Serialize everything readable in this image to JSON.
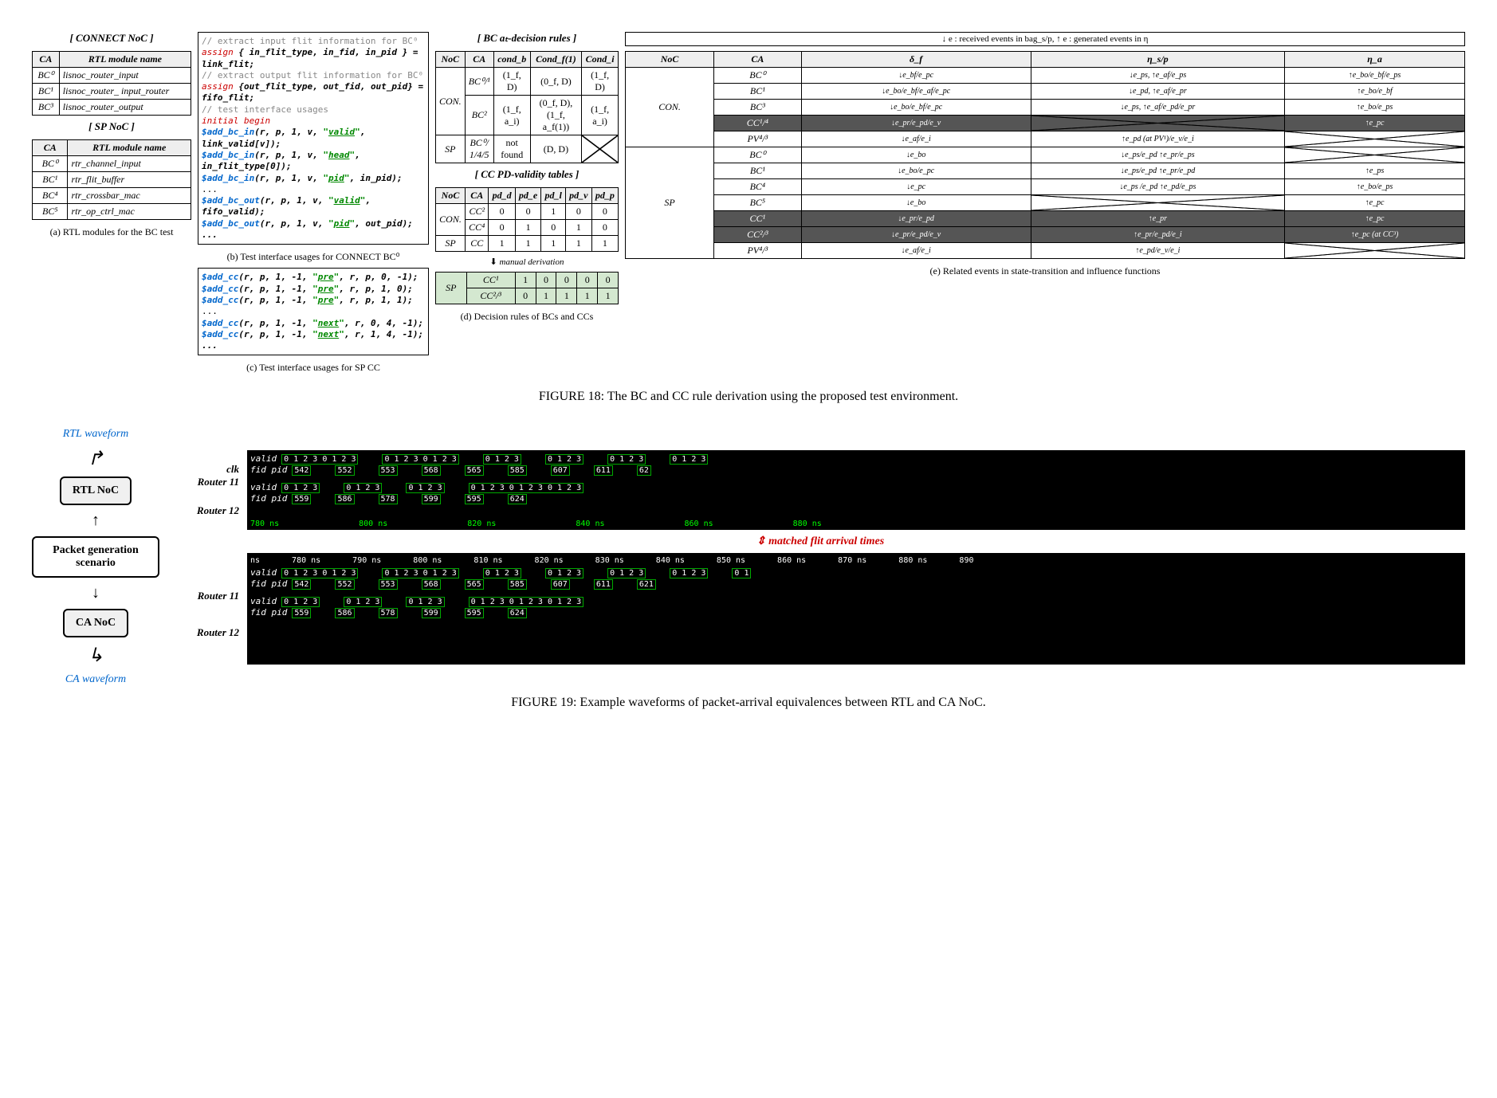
{
  "fig18": {
    "col_a": {
      "title1": "[ CONNECT NoC ]",
      "headers": [
        "CA",
        "RTL module name"
      ],
      "rows1": [
        [
          "BC⁰",
          "lisnoc_router_input"
        ],
        [
          "BC¹",
          "lisnoc_router_ input_router"
        ],
        [
          "BC³",
          "lisnoc_router_output"
        ]
      ],
      "title2": "[ SP NoC ]",
      "rows2": [
        [
          "BC⁰",
          "rtr_channel_input"
        ],
        [
          "BC¹",
          "rtr_flit_buffer"
        ],
        [
          "BC⁴",
          "rtr_crossbar_mac"
        ],
        [
          "BC⁵",
          "rtr_op_ctrl_mac"
        ]
      ],
      "caption": "(a) RTL modules for the BC test"
    },
    "col_b": {
      "lines": [
        {
          "type": "comment",
          "text": "// extract input flit information for BC⁰"
        },
        {
          "type": "assign",
          "text": "assign { in_flit_type, in_fid, in_pid } = link_flit;"
        },
        {
          "type": "comment",
          "text": "// extract output flit information for BC⁰"
        },
        {
          "type": "assign",
          "text": "assign {out_flit_type, out_fid, out_pid} = fifo_flit;"
        },
        {
          "type": "comment",
          "text": "// test interface usages"
        },
        {
          "type": "initial",
          "text": "initial begin"
        },
        {
          "type": "call",
          "fn": "$add_bc_in",
          "args": "(r, p, 1, v, \"valid\", link_valid[v]);"
        },
        {
          "type": "call",
          "fn": "$add_bc_in",
          "args": "(r, p, 1, v, \"head\", in_flit_type[0]);"
        },
        {
          "type": "call",
          "fn": "$add_bc_in",
          "args": "(r, p, 1, v, \"pid\", in_pid);"
        },
        {
          "type": "plain",
          "text": "..."
        },
        {
          "type": "call",
          "fn": "$add_bc_out",
          "args": "(r, p, 1, v, \"valid\", fifo_valid);"
        },
        {
          "type": "call",
          "fn": "$add_bc_out",
          "args": "(r, p, 1, v, \"pid\", out_pid);   ..."
        }
      ],
      "caption_b": "(b) Test interface usages for CONNECT BC⁰",
      "lines_c": [
        {
          "fn": "$add_cc",
          "args": "(r, p, 1, -1, \"pre\", r, p, 0, -1);"
        },
        {
          "fn": "$add_cc",
          "args": "(r, p, 1, -1, \"pre\", r, p, 1, 0);"
        },
        {
          "fn": "$add_cc",
          "args": "(r, p, 1, -1, \"pre\", r, p, 1, 1);"
        },
        {
          "fn": "plain",
          "args": "..."
        },
        {
          "fn": "$add_cc",
          "args": "(r, p, 1, -1, \"next\", r, 0, 4, -1);"
        },
        {
          "fn": "$add_cc",
          "args": "(r, p, 1, -1, \"next\", r, 1, 4, -1);   ..."
        }
      ],
      "caption_c": "(c) Test interface usages for SP CC"
    },
    "col_d": {
      "title1": "[ BC aₜ-decision rules ]",
      "t1_headers": [
        "NoC",
        "CA",
        "cond_b",
        "Cond_f(1)",
        "Cond_i"
      ],
      "t1_rows": [
        [
          "CON.",
          "BC⁰/¹",
          "(1_f, D)",
          "(0_f, D)",
          "(1_f, D)"
        ],
        [
          "",
          "BC²",
          "(1_f, a_i)",
          "(0_f, D), (1_f, a_f(1))",
          "(1_f, a_i)"
        ],
        [
          "SP",
          "BC⁰/ 1/4/5",
          "not found",
          "(D, D)",
          "CROSS"
        ]
      ],
      "title2": "[ CC PD-validity tables ]",
      "t2_headers": [
        "NoC",
        "CA",
        "pd_d",
        "pd_e",
        "pd_l",
        "pd_v",
        "pd_p"
      ],
      "t2_rows": [
        [
          "CON.",
          "CC²",
          "0",
          "0",
          "1",
          "0",
          "0"
        ],
        [
          "",
          "CC⁴",
          "0",
          "1",
          "0",
          "1",
          "0"
        ],
        [
          "SP",
          "CC",
          "1",
          "1",
          "1",
          "1",
          "1"
        ]
      ],
      "deriv_label": "manual derivation",
      "t3_rows": [
        [
          "SP",
          "CC¹",
          "1",
          "0",
          "0",
          "0",
          "0"
        ],
        [
          "",
          "CC²/³",
          "0",
          "1",
          "1",
          "1",
          "1"
        ]
      ],
      "caption": "(d) Decision rules of BCs and CCs"
    },
    "col_e": {
      "legend": "↓ e : received events in bag_s/p, ↑ e : generated events in η",
      "headers": [
        "NoC",
        "CA",
        "δ_f",
        "η_s/p",
        "η_a"
      ],
      "rows_con": [
        {
          "ca": "BC⁰",
          "d": "↓e_bf/e_pc",
          "n": "↓e_ps, ↑e_af/e_ps",
          "a": "↑e_bo/e_bf/e_ps"
        },
        {
          "ca": "BC¹",
          "d": "↓e_bo/e_bf/e_af/e_pc",
          "n": "↓e_pd, ↑e_af/e_pr",
          "a": "↑e_bo/e_bf"
        },
        {
          "ca": "BC³",
          "d": "↓e_bo/e_bf/e_pc",
          "n": "↓e_ps, ↑e_af/e_pd/e_pr",
          "a": "↑e_bo/e_ps"
        },
        {
          "ca": "CC¹/⁴",
          "d": "↓e_pr/e_pd/e_v",
          "n": "CROSS",
          "a": "↑e_pc",
          "dark": true
        },
        {
          "ca": "PV⁴/³",
          "d": "↓e_af/e_i",
          "n": "↑e_pd (at PV¹)/e_v/e_i",
          "a": "CROSS"
        }
      ],
      "rows_sp": [
        {
          "ca": "BC⁰",
          "d": "↓e_bo",
          "n": "↓e_ps/e_pd ↑e_pr/e_ps",
          "a": "CROSS"
        },
        {
          "ca": "BC¹",
          "d": "↓e_bo/e_pc",
          "n": "↓e_ps/e_pd ↑e_pr/e_pd",
          "a": "↑e_ps"
        },
        {
          "ca": "BC⁴",
          "d": "↓e_pc",
          "n": "↓e_ps /e_pd ↑e_pd/e_ps",
          "a": "↑e_bo/e_ps"
        },
        {
          "ca": "BC⁵",
          "d": "↓e_bo",
          "n": "CROSS",
          "a": "↑e_pc"
        },
        {
          "ca": "CC¹",
          "d": "↓e_pr/e_pd",
          "n": "↑e_pr",
          "a": "↑e_pc",
          "dark": true
        },
        {
          "ca": "CC²/³",
          "d": "↓e_pr/e_pd/e_v",
          "n": "↑e_pr/e_pd/e_i",
          "a": "↑e_pc (at CC³)",
          "dark": true
        },
        {
          "ca": "PV⁴/³",
          "d": "↓e_af/e_i",
          "n": "↑e_pd/e_v/e_i",
          "a": "CROSS"
        }
      ],
      "noc_con": "CON.",
      "noc_sp": "SP",
      "caption": "(e) Related events in state-transition and influence functions"
    },
    "caption": "FIGURE 18: The BC and CC rule derivation using the proposed test environment."
  },
  "fig19": {
    "rtl_waveform_label": "RTL waveform",
    "ca_waveform_label": "CA waveform",
    "rtl_noc": "RTL NoC",
    "pkt_gen": "Packet generation scenario",
    "ca_noc": "CA NoC",
    "clk": "clk",
    "router11": "Router 11",
    "router12": "Router 12",
    "sigs": [
      "valid",
      "fid",
      "pid"
    ],
    "matched": "matched flit arrival times",
    "rtl_wave": {
      "r11_seq": [
        "0 1 2 3 0 1 2 3",
        "0 1 2 3 0 1 2 3",
        "0 1 2 3",
        "0 1 2 3",
        "0 1 2 3",
        "0 1 2 3"
      ],
      "r11_pid": [
        "542",
        "552",
        "553",
        "568",
        "565",
        "585",
        "607",
        "611",
        "62"
      ],
      "r12_seq": [
        "0 1 2 3",
        "0 1 2 3",
        "0 1 2 3",
        "0 1 2 3 0 1 2 3 0 1 2 3"
      ],
      "r12_pid": [
        "559",
        "586",
        "578",
        "599",
        "595",
        "624"
      ],
      "times": [
        "780 ns",
        "800 ns",
        "820 ns",
        "840 ns",
        "860 ns",
        "880 ns"
      ]
    },
    "ca_wave": {
      "times_top": [
        "ns",
        "780 ns",
        "790 ns",
        "800 ns",
        "810 ns",
        "820 ns",
        "830 ns",
        "840 ns",
        "850 ns",
        "860 ns",
        "870 ns",
        "880 ns",
        "890"
      ],
      "r11_seq": [
        "0 1 2 3 0 1 2 3",
        "0 1 2 3 0 1 2 3",
        "0 1 2 3",
        "0 1 2 3",
        "0 1 2 3",
        "0 1 2 3",
        "0 1"
      ],
      "r11_pid": [
        "542",
        "552",
        "553",
        "568",
        "565",
        "585",
        "607",
        "611",
        "621"
      ],
      "r12_seq": [
        "0 1 2 3",
        "0 1 2 3",
        "0 1 2 3",
        "0 1 2 3 0 1 2 3 0 1 2 3"
      ],
      "r12_pid": [
        "559",
        "586",
        "578",
        "599",
        "595",
        "624"
      ]
    },
    "caption": "FIGURE 19: Example waveforms of packet-arrival equivalences between RTL and CA NoC."
  }
}
